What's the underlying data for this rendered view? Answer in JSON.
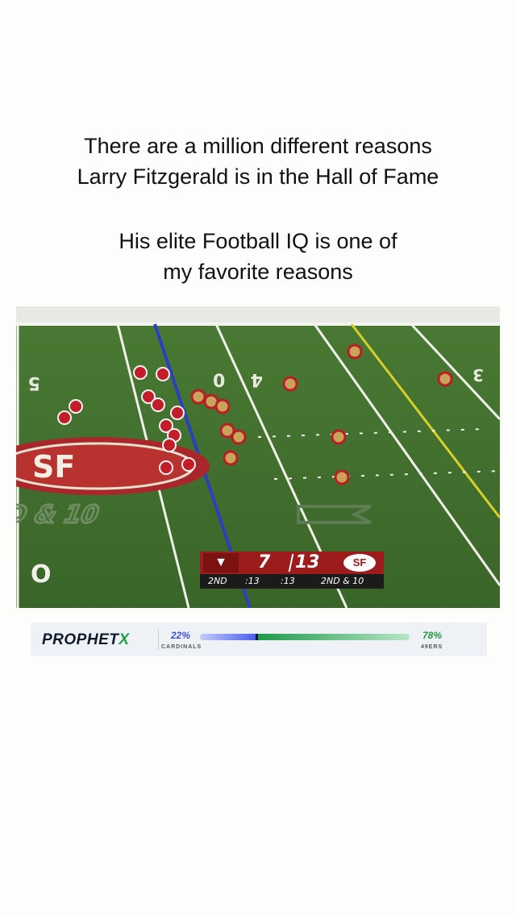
{
  "caption": {
    "line1": "There are a million different reasons",
    "line2": "Larry Fitzgerald is in the Hall of Fame",
    "line3": "His elite Football IQ is one of",
    "line4": "my favorite reasons"
  },
  "video": {
    "field_text": {
      "yard_left": "5",
      "yard_40_a": "0",
      "yard_40_b": "4",
      "yard_30": "3",
      "yard_bottom": "O",
      "down_distance": "2ND & 10"
    },
    "scorebug": {
      "away_logo": "cardinals-logo",
      "away_score": "7",
      "home_score": "13",
      "home_logo_text": "SF",
      "quarter": "2ND",
      "game_clock": ":13",
      "play_clock": ":13",
      "down": "2ND & 10"
    }
  },
  "ad": {
    "brand": "PROPHET",
    "brand_x": "X",
    "away_pct": "22%",
    "away_team": "CARDINALS",
    "home_pct": "78%",
    "home_team": "49ERS",
    "away_fraction": 0.22,
    "colors": {
      "away": "#3b4fd8",
      "home": "#1f9a4a"
    }
  }
}
